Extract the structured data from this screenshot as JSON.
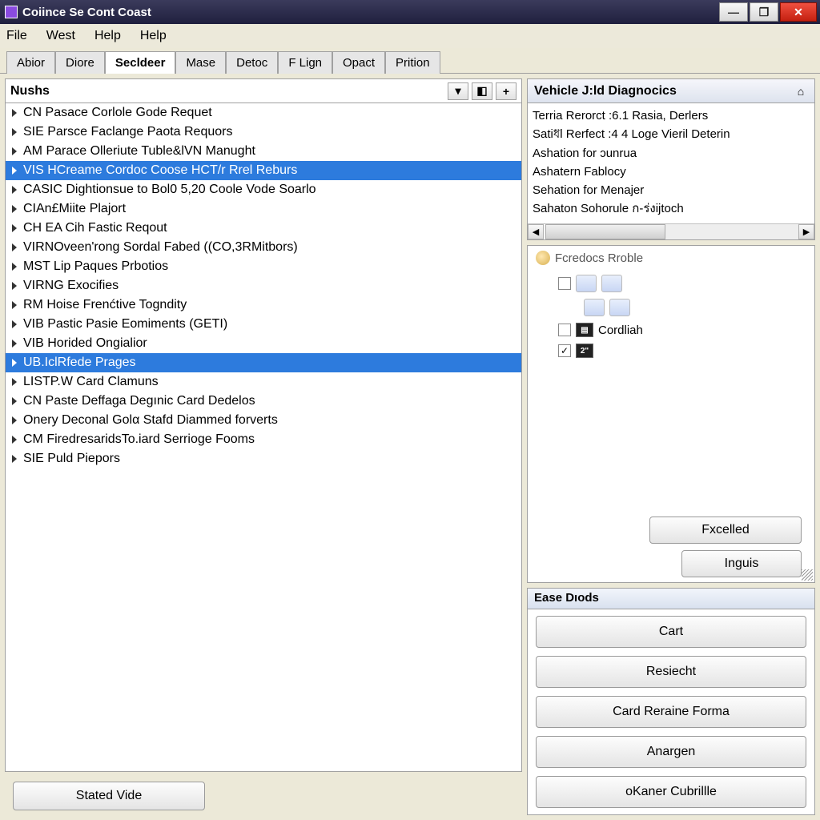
{
  "window_title": "Coiince Se Cont Coast",
  "menu": [
    "File",
    "West",
    "Help",
    "Help"
  ],
  "tabs": [
    "Abior",
    "Diore",
    "Secldeer",
    "Mase",
    "Detoc",
    "F Lign",
    "Opact",
    "Prition"
  ],
  "active_tab_index": 2,
  "nushs": {
    "label": "Nushs",
    "items": [
      "CN Pasace Corlole Gode Requet",
      "SIE Parsce Faclange Paota Requors",
      "AM Parace Olleriute Tuble&lVN Manught",
      "VIS HCreame Cordoc Coose HCT/r Rrel Reburs",
      "CASIC Dightionsue to Bol0 5,20 Coole Vode Soarlo",
      "CIAn£Miite Plajort",
      "CH EA Cih Fastic Reqout",
      "VIRNOveen'rong Sordal Fabed ((CO,3RMitbors)",
      "MST Lip Paques Prbotios",
      "VIRNG Exocifies",
      "RM Hoise Frenćtive Togndity",
      "VIB Pastic Pasie Eomiments  (GETI)",
      "VIB Horided Ongialior",
      "UB.IclRfede Prages",
      "LISTP.W Card Clamuns",
      "CN Paste Deffaga Degınic Card Dedelos",
      "Onery Deconal Golα Stafd Diammed forverts",
      "CM FiredresaridsTo.iard Serrioge Fooms",
      "SIE Puld Piepors"
    ],
    "selected_indexes": [
      3,
      13
    ]
  },
  "diag": {
    "title": "Vehicle J:ld Diagnocics",
    "lines": [
      "Terria Rerorct :6.1 Rasia, Derlers",
      "Satiধl Rerfect :4 4 Loge Vieril Deterin",
      "Ashation for ɔunrua",
      "Ashatern Fablocy",
      "Sehation for Menajer",
      "Sahaton  Sohorule ก-ร่งijtoch"
    ]
  },
  "credocs": {
    "title": "Fcredocs Rroble",
    "cordliah_label": "Cordliah",
    "z_label": "2\"",
    "buttons": {
      "fxcelled": "Fxcelled",
      "inguis": "Inguis"
    }
  },
  "actions": {
    "title": "Ease Dıods",
    "buttons": [
      "Cart",
      "Resiecht",
      "Card Reraine Forma",
      "Anargen",
      "oKaner Cubrillle"
    ]
  },
  "bottom_button": "Stated Vide"
}
